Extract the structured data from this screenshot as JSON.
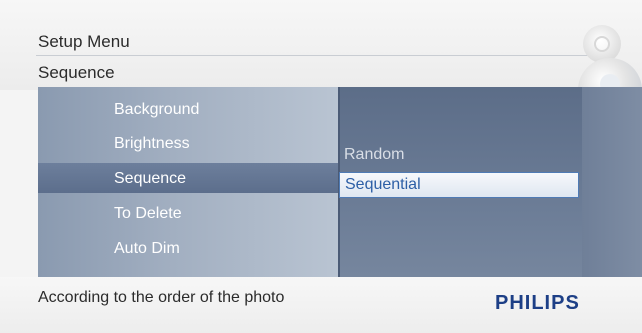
{
  "header": {
    "title": "Setup Menu",
    "subtitle": "Sequence"
  },
  "menu": {
    "items": [
      {
        "label": "Background"
      },
      {
        "label": "Brightness"
      },
      {
        "label": "Sequence",
        "selected": true
      },
      {
        "label": "To Delete"
      },
      {
        "label": "Auto Dim"
      }
    ]
  },
  "options": {
    "items": [
      {
        "label": "Random"
      },
      {
        "label": "Sequential",
        "selected": true
      }
    ]
  },
  "footer": {
    "status": "According to the order of the photo",
    "brand": "PHILIPS"
  },
  "colors": {
    "brand": "#1d3f86",
    "selection_text": "#2d5fa6",
    "panel": "#6f7f98"
  },
  "icons": [
    "settings-dial-icon",
    "joystick-icon",
    "square-button-icon"
  ]
}
